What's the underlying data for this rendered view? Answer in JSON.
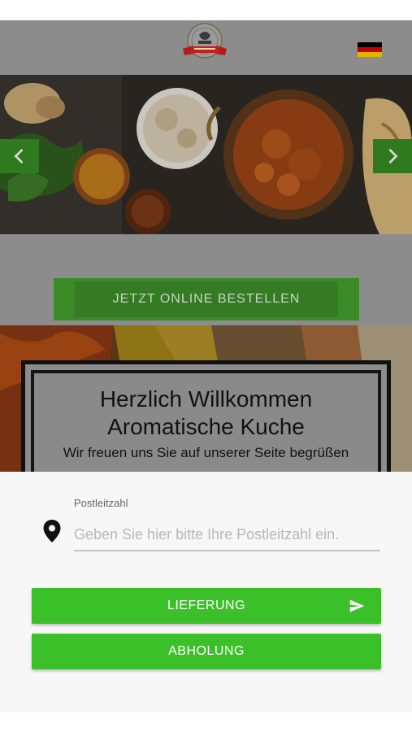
{
  "header": {
    "logo_icon": "restaurant-logo-icon",
    "language_flag_icon": "german-flag-icon"
  },
  "carousel": {
    "prev_icon": "chevron-left-icon",
    "next_icon": "chevron-right-icon"
  },
  "order_button": {
    "label": "JETZT ONLINE BESTELLEN"
  },
  "welcome": {
    "line1": "Herzlich Willkommen",
    "line2": "Aromatische Kuche",
    "line3": "Wir freuen uns Sie auf unserer Seite begrüßen"
  },
  "postcode": {
    "label": "Postleitzahl",
    "placeholder": "Geben Sie hier bitte Ihre Postleitzahl ein.",
    "value": ""
  },
  "delivery_button": {
    "label": "LIEFERUNG",
    "icon": "send-icon"
  },
  "pickup_button": {
    "label": "ABHOLUNG"
  },
  "colors": {
    "accent_green": "#3cc029",
    "overlay_gray": "#8c8c8c",
    "sheet_background": "#f7f7f7"
  }
}
